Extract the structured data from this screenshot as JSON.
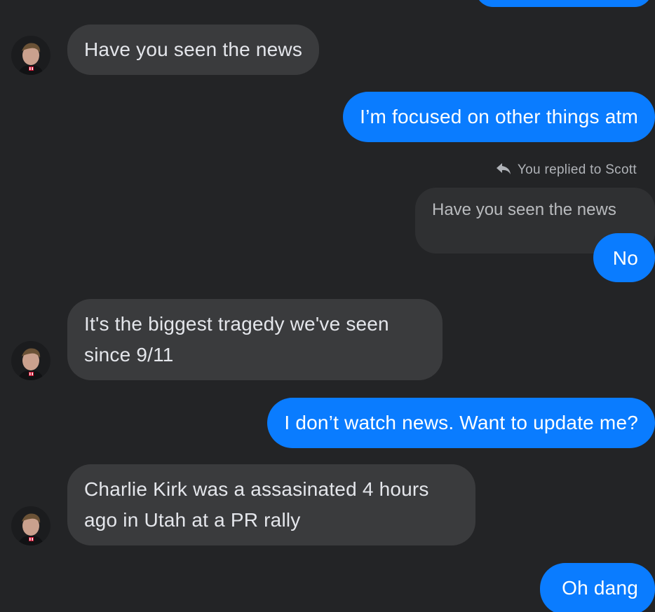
{
  "colors": {
    "background": "#232426",
    "incoming_bubble": "#3a3b3d",
    "outgoing_bubble": "#0a7cff",
    "quoted_bubble": "#2f3032",
    "meta_text": "#b0b3b8"
  },
  "contact": {
    "avatar_icon": "profile-photo"
  },
  "messages": [
    {
      "direction": "incoming",
      "text": "Have you seen the news"
    },
    {
      "direction": "outgoing",
      "text": "I’m focused on other things atm"
    },
    {
      "direction": "reply_meta",
      "text": "You replied to Scott",
      "icon": "reply-arrow-icon"
    },
    {
      "direction": "quoted",
      "text": "Have you seen the news"
    },
    {
      "direction": "outgoing",
      "text": "No"
    },
    {
      "direction": "incoming",
      "lines": [
        "It's the biggest tragedy we've seen",
        "since 9/11"
      ]
    },
    {
      "direction": "outgoing",
      "text": "I don’t watch news. Want to update me?"
    },
    {
      "direction": "incoming",
      "lines": [
        "Charlie Kirk was a assasinated 4 hours",
        "ago in Utah at a PR rally"
      ]
    },
    {
      "direction": "outgoing",
      "text": "Oh dang"
    }
  ]
}
